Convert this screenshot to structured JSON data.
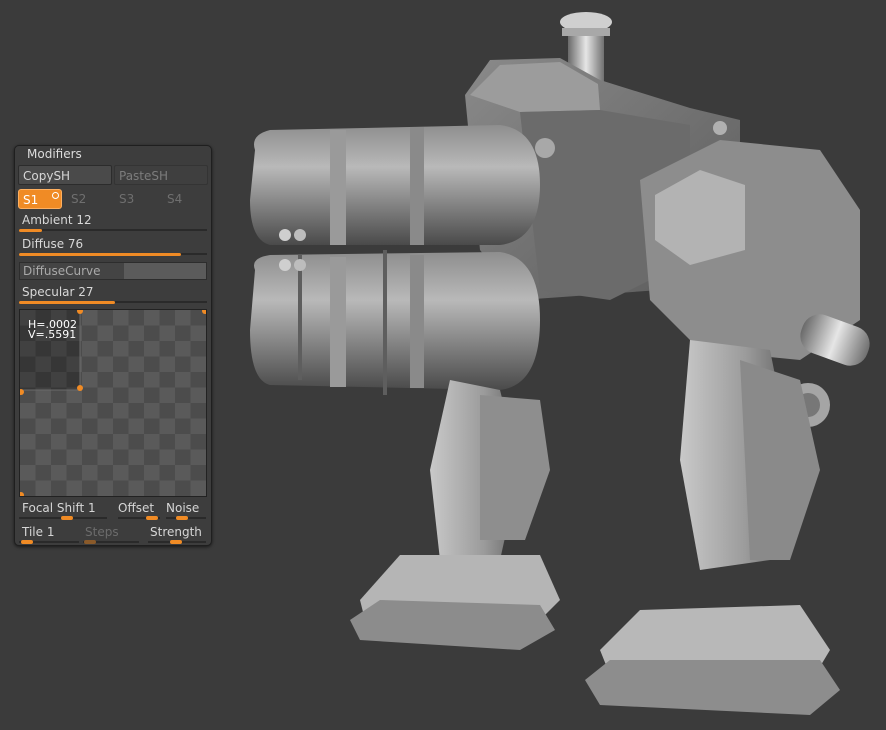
{
  "panel": {
    "title": "Modifiers",
    "copy_label": "CopySH",
    "paste_label": "PasteSH",
    "slots": [
      "S1",
      "S2",
      "S3",
      "S4"
    ],
    "active_slot": "S1",
    "ambient": {
      "label": "Ambient",
      "value": "12",
      "fraction": 0.12
    },
    "diffuse": {
      "label": "Diffuse",
      "value": "76",
      "fraction": 0.86
    },
    "diffuse_curve_label": "DiffuseCurve",
    "specular": {
      "label": "Specular",
      "value": "27",
      "fraction": 0.51
    },
    "curve": {
      "h": "H=.0002",
      "v": "V=.5591"
    },
    "focal_shift": {
      "label": "Focal Shift",
      "value": "1"
    },
    "offset_label": "Offset",
    "noise_label": "Noise",
    "tile": {
      "label": "Tile",
      "value": "1"
    },
    "steps_label": "Steps",
    "strength_label": "Strength"
  },
  "colors": {
    "accent": "#f08b25",
    "background": "#3b3b3b",
    "panel": "#3d3d3d"
  },
  "viewport": {
    "subject": "mech-robot-model"
  }
}
